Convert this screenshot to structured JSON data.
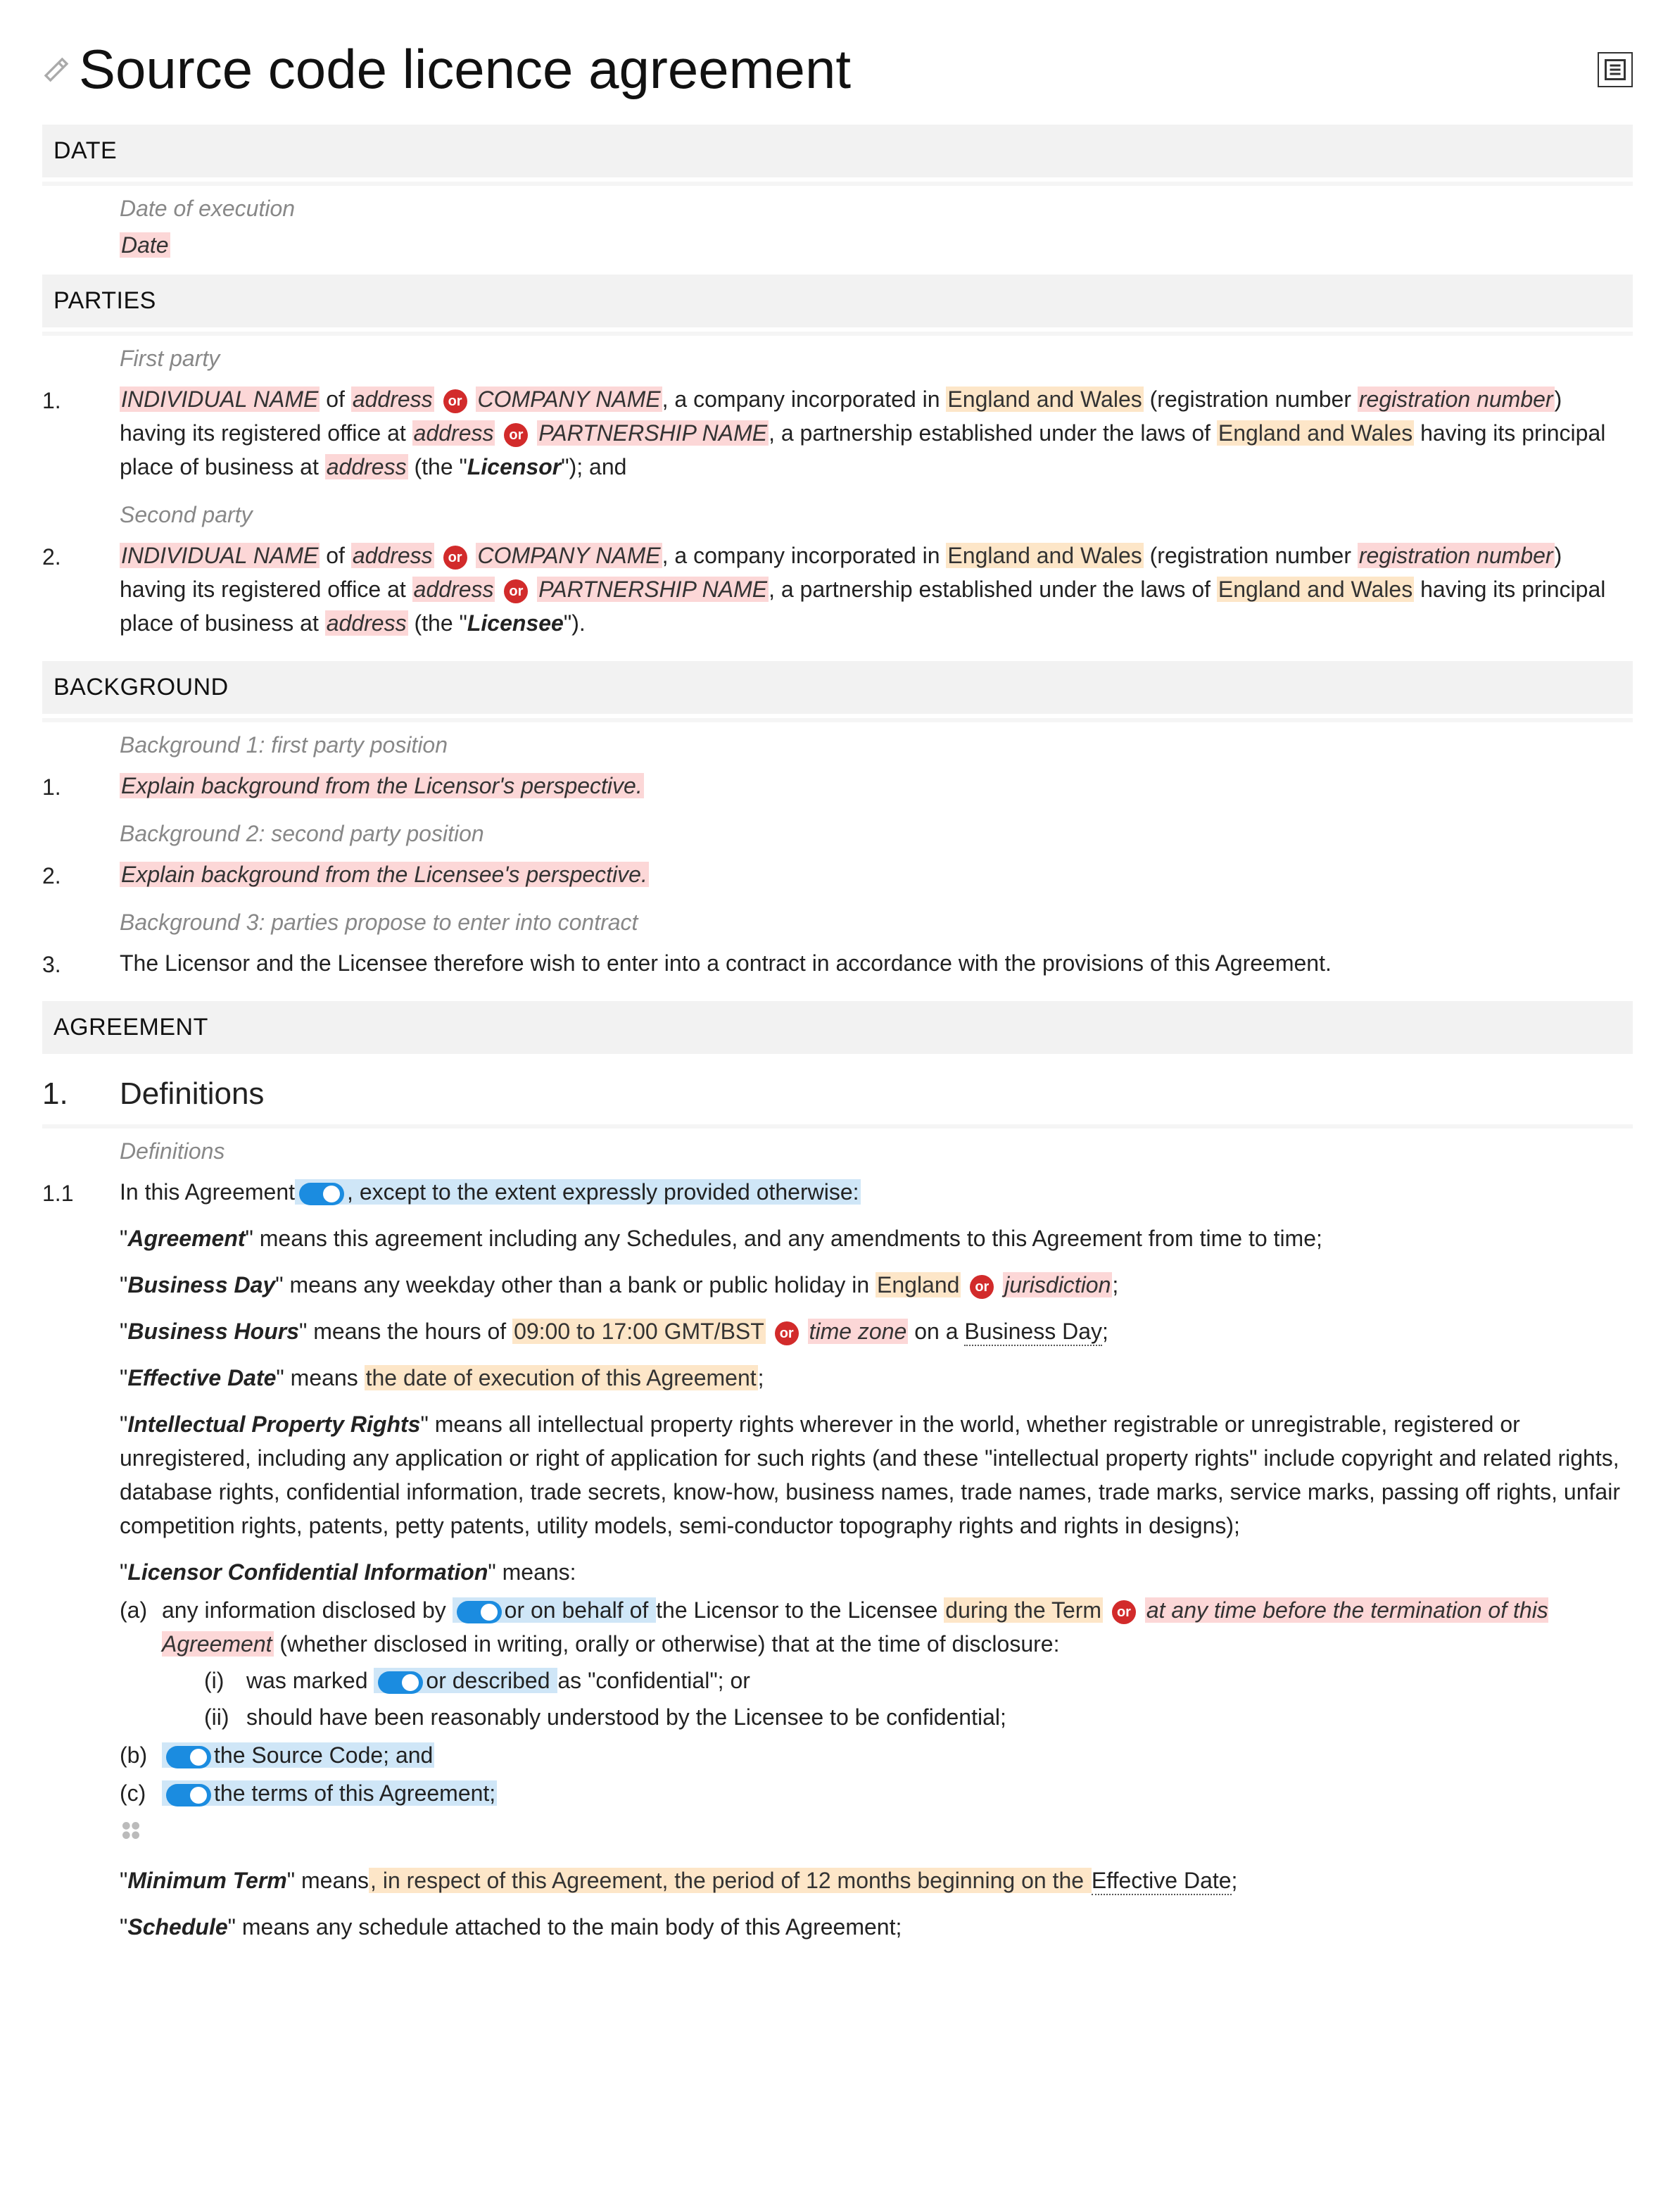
{
  "title": "Source code licence agreement",
  "icons": {
    "edit": "edit-icon",
    "toc": "toc-icon"
  },
  "sections": {
    "date": {
      "heading": "DATE",
      "note": "Date of execution",
      "placeholder": "Date"
    },
    "parties": {
      "heading": "PARTIES",
      "first_note": "First party",
      "second_note": "Second party",
      "p1": {
        "num": "1.",
        "individual": "INDIVIDUAL NAME",
        "of_text": " of ",
        "address1": "address",
        "or1": "or",
        "company": "COMPANY NAME",
        "inc_text": ", a company incorporated in ",
        "jurisdiction1": "England and Wales",
        "reg_text_open": " (registration number ",
        "regnum": "registration number",
        "reg_text_close": ") having its registered office at ",
        "address2": "address",
        "or2": "or",
        "partnership": "PARTNERSHIP NAME",
        "partnership_text": ", a partnership established under the laws of ",
        "jurisdiction2": "England and Wales",
        "principal_text": " having its principal place of business at ",
        "address3": "address",
        "role_open": " (the \"",
        "role": "Licensor",
        "role_close": "\"); and"
      },
      "p2": {
        "num": "2.",
        "individual": "INDIVIDUAL NAME",
        "of_text": " of ",
        "address1": "address",
        "or1": "or",
        "company": "COMPANY NAME",
        "inc_text": ", a company incorporated in ",
        "jurisdiction1": "England and Wales",
        "reg_text_open": " (registration number ",
        "regnum": "registration number",
        "reg_text_close": ") having its registered office at ",
        "address2": "address",
        "or2": "or",
        "partnership": "PARTNERSHIP NAME",
        "partnership_text": ", a partnership established under the laws of ",
        "jurisdiction2": "England and Wales",
        "principal_text": " having its principal place of business at ",
        "address3": "address",
        "role_open": " (the \"",
        "role": "Licensee",
        "role_close": "\")."
      }
    },
    "background": {
      "heading": "BACKGROUND",
      "items": [
        {
          "num": "1.",
          "note": "Background 1: first party position",
          "text": "Explain background from the Licensor's perspective.",
          "is_placeholder": true
        },
        {
          "num": "2.",
          "note": "Background 2: second party position",
          "text": "Explain background from the Licensee's perspective.",
          "is_placeholder": true
        },
        {
          "num": "3.",
          "note": "Background 3: parties propose to enter into contract",
          "text": "The Licensor and the Licensee therefore wish to enter into a contract in accordance with the provisions of this Agreement.",
          "is_placeholder": false
        }
      ]
    },
    "agreement": {
      "heading": "AGREEMENT",
      "clause1": {
        "num": "1.",
        "title": "Definitions",
        "sub_note": "Definitions",
        "c11": {
          "num": "1.1",
          "intro_pre": "In this Agreement",
          "intro_blue": ", except to the extent expressly provided otherwise:",
          "defs": {
            "agreement": {
              "term": "Agreement",
              "body": "\" means this agreement including any Schedules, and any amendments to this Agreement from time to time;"
            },
            "business_day": {
              "term": "Business Day",
              "body_pre": "\" means any weekday other than a bank or public holiday in ",
              "opt1": "England",
              "or": "or",
              "opt2": "jurisdiction",
              "body_post": ";"
            },
            "business_hours": {
              "term": "Business Hours",
              "body_pre": "\" means the hours of ",
              "opt1": "09:00 to 17:00 GMT/BST",
              "or": "or",
              "opt2": "time zone",
              "body_mid": " on a ",
              "bd": "Business Day",
              "body_post": ";"
            },
            "effective_date": {
              "term": "Effective Date",
              "body_pre": "\" means ",
              "opt1": "the date of execution of this Agreement",
              "body_post": ";"
            },
            "ipr": {
              "term": "Intellectual Property Rights",
              "body": "\" means all intellectual property rights wherever in the world, whether registrable or unregistrable, registered or unregistered, including any application or right of application for such rights (and these \"intellectual property rights\" include copyright and related rights, database rights, confidential information, trade secrets, know-how, business names, trade names, trade marks, service marks, passing off rights, unfair competition rights, patents, petty patents, utility models, semi-conductor topography rights and rights in designs);"
            },
            "lci": {
              "term": "Licensor Confidential Information",
              "body_head": "\" means:",
              "a": {
                "label": "(a)",
                "pre": "any information disclosed by ",
                "blue1": "or on behalf of ",
                "mid": "the Licensor to the Licensee ",
                "orange1": "during the Term",
                "or": "or",
                "red1": "at any time before the termination of this Agreement",
                "post": " (whether disclosed in writing, orally or otherwise) that at the time of disclosure:"
              },
              "a_i": {
                "label": "(i)",
                "pre": "was marked ",
                "blue": "or described ",
                "post": "as \"confidential\"; or"
              },
              "a_ii": {
                "label": "(ii)",
                "text": "should have been reasonably understood by the Licensee to be confidential;"
              },
              "b": {
                "label": "(b)",
                "blue": "the Source Code; and"
              },
              "c": {
                "label": "(c)",
                "blue": "the terms of this Agreement;"
              }
            },
            "minimum_term": {
              "term": "Minimum Term",
              "body_pre": "\" means",
              "orange": ", in respect of this Agreement, the period of 12 months beginning on the ",
              "ed": "Effective Date",
              "body_post": ";"
            },
            "schedule": {
              "term": "Schedule",
              "body": "\" means any schedule attached to the main body of this Agreement;"
            }
          }
        }
      }
    }
  }
}
